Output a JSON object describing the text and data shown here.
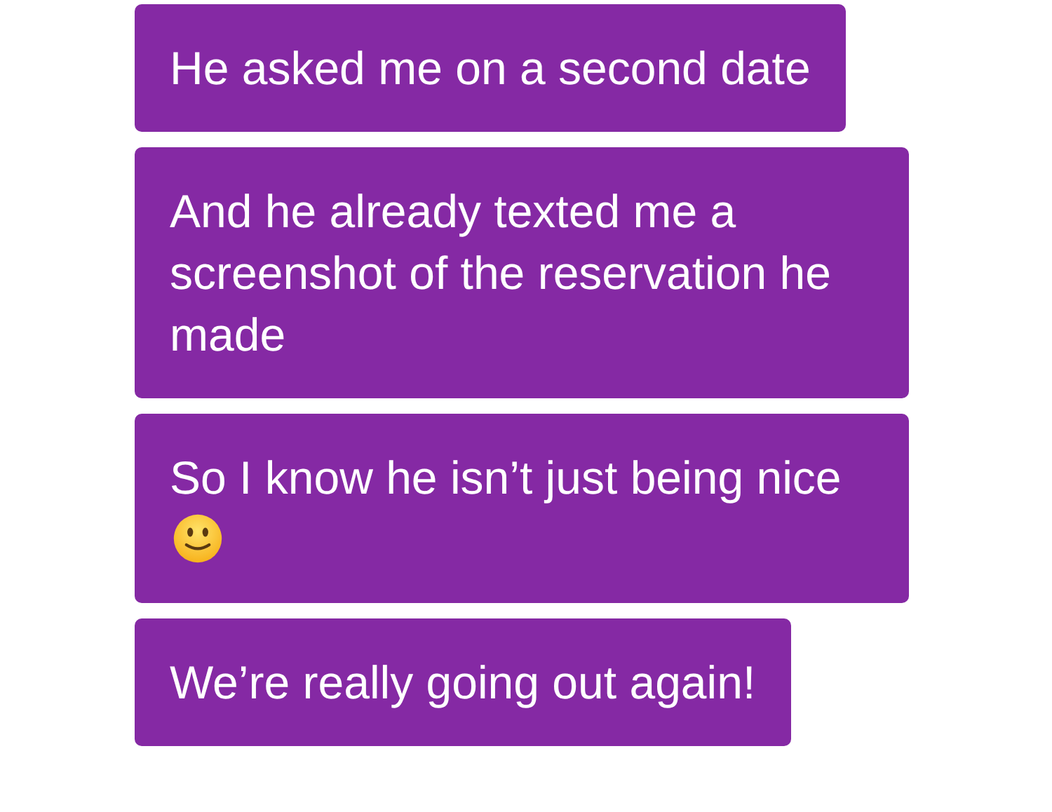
{
  "messages": [
    {
      "kind": "text",
      "text": "He asked me on a second date"
    },
    {
      "kind": "text",
      "text": "And he already texted me a screenshot of the reservation he made"
    },
    {
      "kind": "text_smile",
      "text": "So I know he isn’t just being nice"
    },
    {
      "kind": "text",
      "text": "We’re really going out again!"
    }
  ]
}
